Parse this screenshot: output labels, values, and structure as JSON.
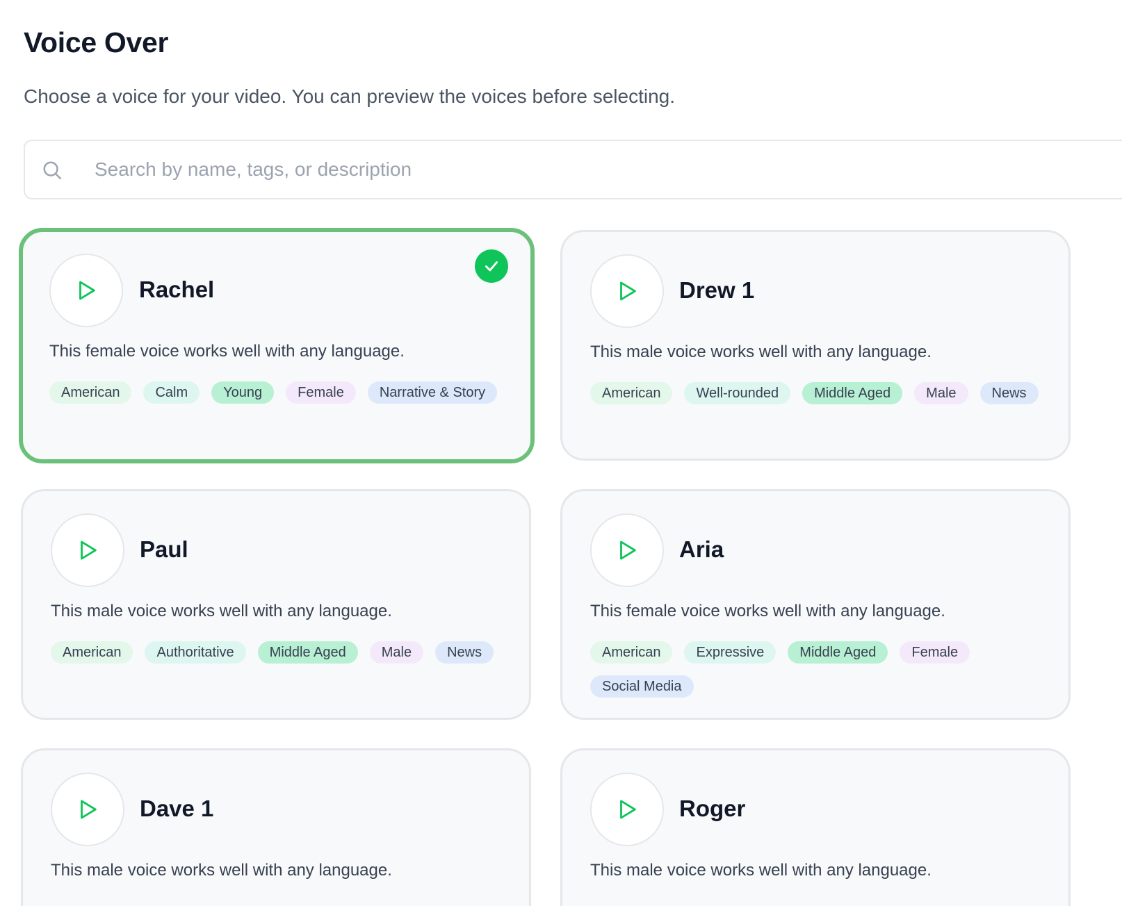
{
  "header": {
    "title": "Voice Over",
    "subtitle": "Choose a voice for your video. You can preview the voices before selecting."
  },
  "search": {
    "placeholder": "Search by name, tags, or description",
    "value": ""
  },
  "colors": {
    "accent": "#0fc559",
    "selected_border": "#6cc17a"
  },
  "voices": [
    {
      "name": "Rachel",
      "selected": true,
      "description": "This female voice works well with any language.",
      "tags": [
        "American",
        "Calm",
        "Young",
        "Female",
        "Narrative & Story"
      ]
    },
    {
      "name": "Drew 1",
      "selected": false,
      "description": "This male voice works well with any language.",
      "tags": [
        "American",
        "Well-rounded",
        "Middle Aged",
        "Male",
        "News"
      ]
    },
    {
      "name": "Paul",
      "selected": false,
      "description": "This male voice works well with any language.",
      "tags": [
        "American",
        "Authoritative",
        "Middle Aged",
        "Male",
        "News"
      ]
    },
    {
      "name": "Aria",
      "selected": false,
      "description": "This female voice works well with any language.",
      "tags": [
        "American",
        "Expressive",
        "Middle Aged",
        "Female",
        "Social Media"
      ]
    },
    {
      "name": "Dave 1",
      "selected": false,
      "description": "This male voice works well with any language.",
      "tags": []
    },
    {
      "name": "Roger",
      "selected": false,
      "description": "This male voice works well with any language.",
      "tags": []
    }
  ]
}
